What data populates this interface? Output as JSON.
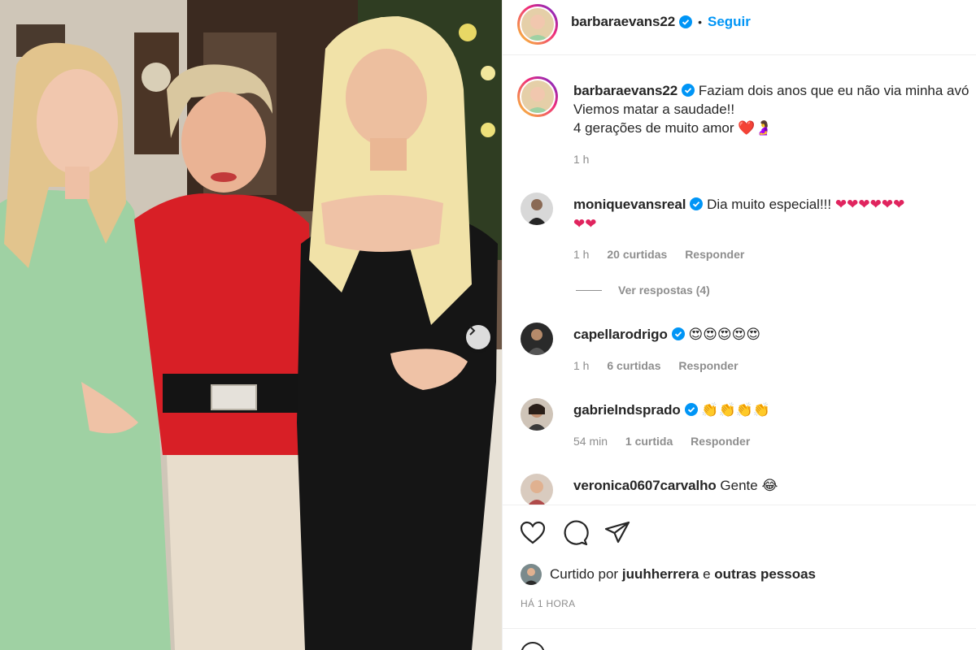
{
  "post": {
    "author": "barbaraevans22",
    "follow_label": "Seguir",
    "separator": "•",
    "caption_lines": [
      "Faziam dois anos que eu não via minha avó",
      "Viemos matar a saudade!!",
      "4 gerações de muito amor"
    ],
    "caption_emoji": "❤️🤰",
    "caption_time": "1 h"
  },
  "comments": [
    {
      "username": "moniquevansreal",
      "verified": true,
      "text": "Dia muito especial!!!",
      "emoji_line1": "❤❤❤❤❤❤",
      "emoji_line2": "❤❤",
      "time": "1 h",
      "likes": "20 curtidas",
      "reply": "Responder",
      "view_replies": "Ver respostas (4)"
    },
    {
      "username": "capellarodrigo",
      "verified": true,
      "text": "",
      "emoji": "😍😍😍😍😍",
      "time": "1 h",
      "likes": "6 curtidas",
      "reply": "Responder"
    },
    {
      "username": "gabrielndsprado",
      "verified": true,
      "text": "",
      "emoji": "👏👏👏👏",
      "time": "54 min",
      "likes": "1 curtida",
      "reply": "Responder"
    },
    {
      "username": "veronica0607carvalho",
      "verified": false,
      "text": "Gente",
      "emoji": "😂"
    }
  ],
  "footer": {
    "liked_by_prefix": "Curtido por",
    "liked_by_user": "juuhherrera",
    "liked_by_and": "e",
    "liked_by_others": "outras pessoas",
    "time_ago": "HÁ 1 HORA"
  },
  "colors": {
    "accent": "#0095f6",
    "secondary_text": "#8e8e8e",
    "heart": "#e0245e",
    "divider": "#efefef"
  },
  "icons": [
    "heart-icon",
    "comment-icon",
    "share-icon",
    "verified-icon",
    "chevron-right-icon",
    "emoji-icon"
  ]
}
